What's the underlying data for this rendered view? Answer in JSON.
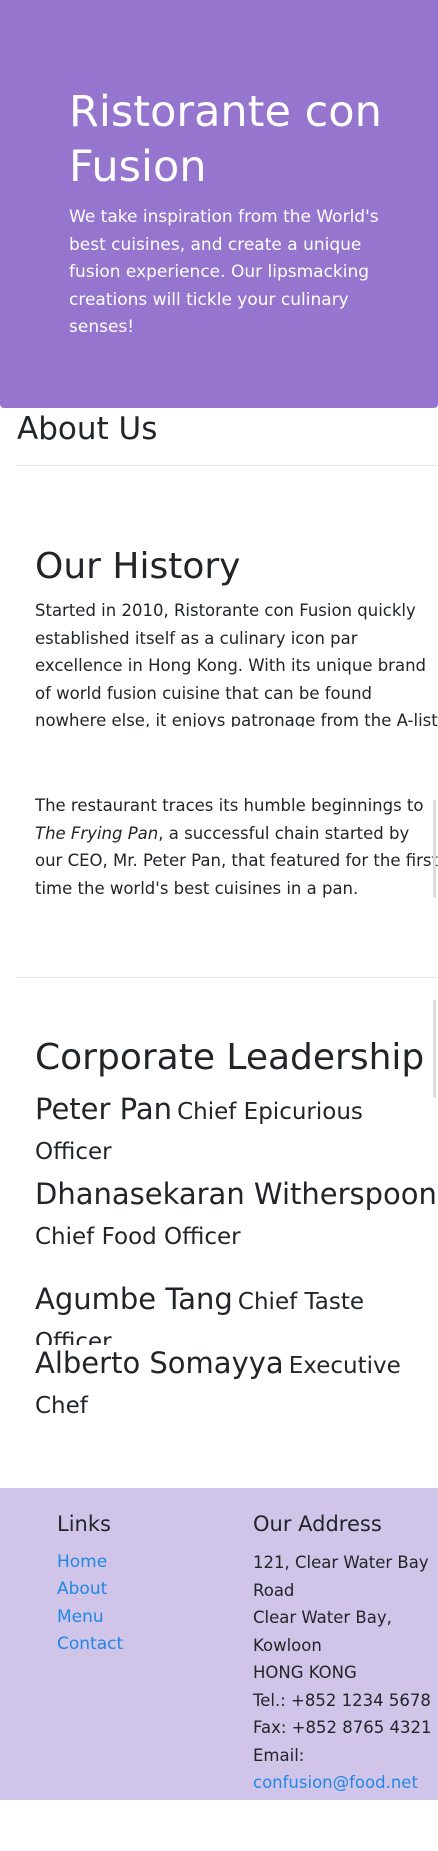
{
  "hero": {
    "title": "Ristorante con Fusion",
    "text": "We take inspiration from the World's best cuisines, and create a unique fusion experience. Our lipsmacking creations will tickle your culinary senses!"
  },
  "about": {
    "heading": "About Us"
  },
  "history": {
    "heading": "Our History",
    "para1": "Started in 2010, Ristorante con Fusion quickly established itself as a culinary icon par excellence in Hong Kong. With its unique brand of world fusion cuisine that can be found nowhere else, it enjoys patronage from the A-list clientele in",
    "para2_before": "The restaurant traces its humble beginnings to ",
    "para2_em": "The Frying Pan",
    "para2_after": ", a successful chain started by our CEO, Mr. Peter Pan, that featured for the first time the world's best cuisines in a pan."
  },
  "leadership": {
    "heading": "Corporate Leadership",
    "leaders": [
      {
        "name": "Peter Pan",
        "role": "Chief Epicurious Officer"
      },
      {
        "name": "Dhanasekaran Witherspoon",
        "role": "Chief Food Officer"
      },
      {
        "name": "Agumbe Tang",
        "role": "Chief Taste Officer"
      },
      {
        "name": "Alberto Somayya",
        "role": "Executive Chef"
      }
    ]
  },
  "footer": {
    "links_heading": "Links",
    "links": [
      "Home",
      "About",
      "Menu",
      "Contact"
    ],
    "address_heading": "Our Address",
    "address_lines": [
      "121, Clear Water Bay Road",
      "Clear Water Bay, Kowloon",
      "HONG KONG"
    ],
    "tel": "Tel.: +852 1234 5678",
    "fax": "Fax: +852 8765 4321",
    "email_label": "Email:",
    "email": "confusion@food.net"
  }
}
